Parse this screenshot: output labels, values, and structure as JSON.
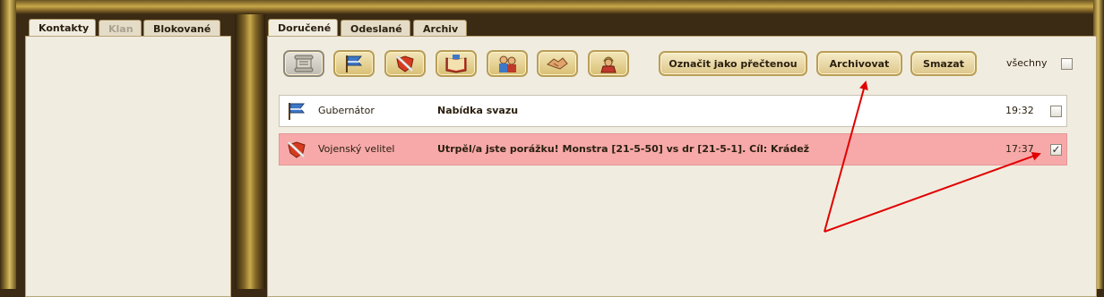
{
  "left_tabs": [
    {
      "label": "Kontakty",
      "state": "active"
    },
    {
      "label": "Klan",
      "state": "disabled"
    },
    {
      "label": "Blokované",
      "state": "normal"
    }
  ],
  "right_tabs": [
    {
      "label": "Doručené",
      "state": "active"
    },
    {
      "label": "Odeslané",
      "state": "normal"
    },
    {
      "label": "Archiv",
      "state": "normal"
    }
  ],
  "toolbar": {
    "icons": [
      "scroll-icon",
      "blue-flag-icon",
      "sword-shield-icon",
      "book-icon",
      "merchants-icon",
      "handshake-icon",
      "soldier-icon"
    ],
    "mark_read_label": "Označit jako přečtenou",
    "archive_label": "Archivovat",
    "delete_label": "Smazat",
    "select_all_label": "všechny"
  },
  "messages": [
    {
      "icon": "blue-flag-icon",
      "sender": "Gubernátor",
      "subject": "Nabídka svazu",
      "time": "19:32",
      "checked": false,
      "highlight": false
    },
    {
      "icon": "sword-shield-icon",
      "sender": "Vojenský velitel",
      "subject": "Utrpěl/a jste porážku! Monstra [21-5-50] vs dr [21-5-1]. Cíl: Krádež",
      "time": "17:37",
      "checked": true,
      "highlight": true
    }
  ],
  "colors": {
    "highlight_row": "#f7a9a9",
    "panel_bg": "#f1ece0",
    "annotation_arrow": "#e00000"
  }
}
